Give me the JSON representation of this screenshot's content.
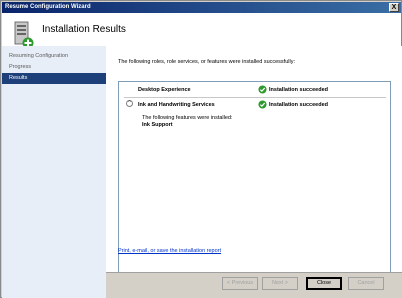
{
  "window": {
    "title": "Resume Configuration Wizard",
    "close_glyph": "X"
  },
  "header": {
    "title": "Installation Results",
    "icon": "server-install-icon"
  },
  "nav": {
    "items": [
      {
        "label": "Resuming Configuration",
        "active": false
      },
      {
        "label": "Progress",
        "active": false
      },
      {
        "label": "Results",
        "active": true
      }
    ]
  },
  "content": {
    "intro": "The following roles, role services, or features were installed successfully:",
    "results": [
      {
        "name": "Desktop Experience",
        "status": "Installation succeeded"
      },
      {
        "name": "Ink and Handwriting Services",
        "status": "Installation succeeded",
        "collapse_glyph": "^"
      }
    ],
    "features_text": "The following features were installed:",
    "features_item": "Ink Support",
    "report_link": "Print, e-mail, or save the installation report"
  },
  "footer": {
    "prev_label": "< Previous",
    "next_label": "Next >",
    "close_label": "Close",
    "cancel_label": "Cancel"
  },
  "colors": {
    "accent": "#1d3f7a",
    "success": "#2e9a2e",
    "link": "#0033cc"
  }
}
